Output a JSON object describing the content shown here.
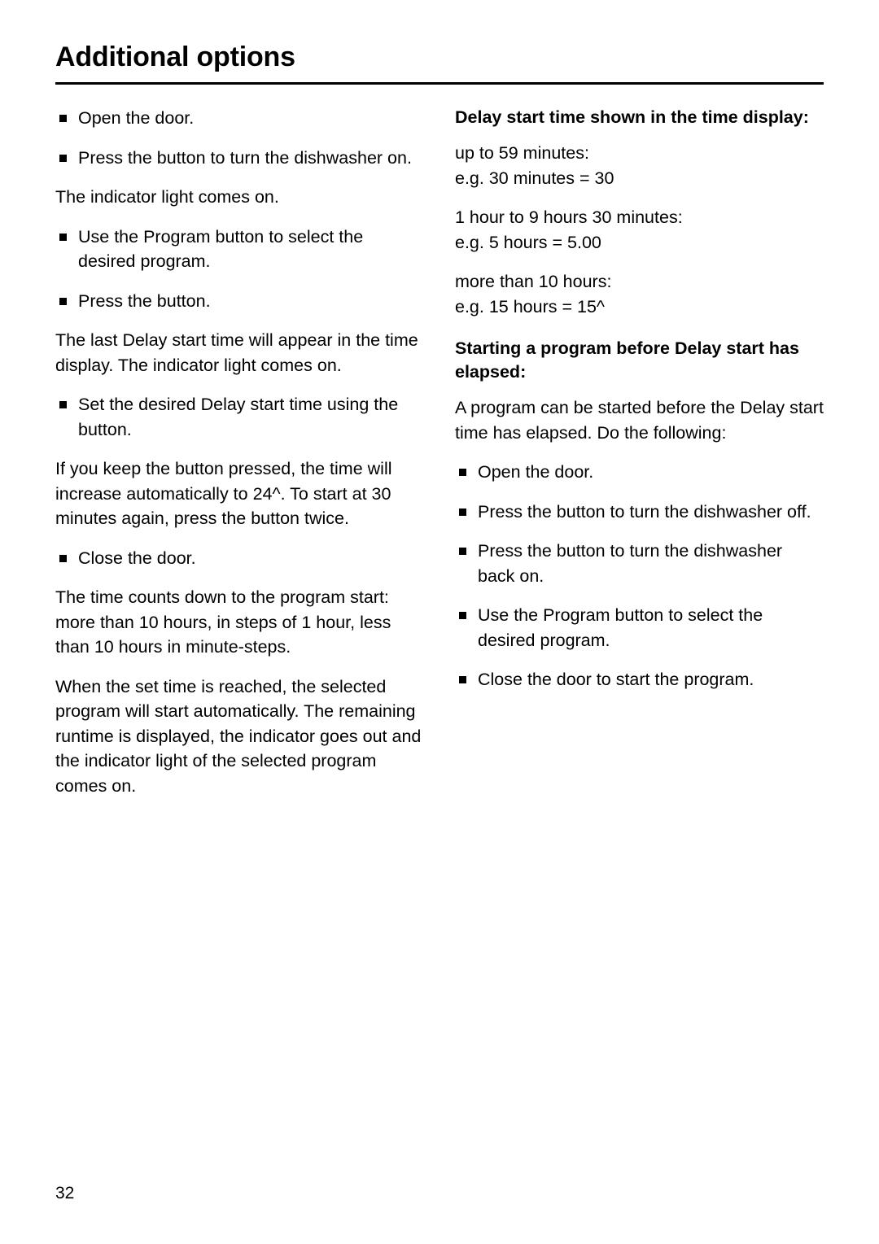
{
  "page": {
    "title": "Additional options",
    "number": "32"
  },
  "left_column": {
    "items": [
      {
        "type": "bullet",
        "text": "Open the door."
      },
      {
        "type": "bullet",
        "text": "Press the  button to turn the dishwasher on."
      },
      {
        "type": "para",
        "text": "The  indicator light comes on."
      },
      {
        "type": "bullet",
        "text": "Use the Program button to select the desired program."
      },
      {
        "type": "bullet",
        "text": "Press the  button."
      },
      {
        "type": "para",
        "text": "The last Delay start time will appear in the time display. The  indicator light comes on."
      },
      {
        "type": "bullet",
        "text": "Set the desired Delay start time using the  button."
      },
      {
        "type": "para",
        "text": "If you keep the  button pressed, the time will increase automatically to 24^. To start at 30 minutes again, press the  button twice."
      },
      {
        "type": "bullet",
        "text": "Close the door."
      },
      {
        "type": "para",
        "text": "The time counts down to the program start: more than 10 hours, in steps of 1 hour, less than 10 hours in minute-steps."
      },
      {
        "type": "para",
        "text": "When the set time is reached, the selected program will start automatically. The remaining runtime is displayed, the  indicator goes out and the indicator light of the selected program comes on."
      }
    ]
  },
  "right_column": {
    "section1": {
      "heading": "Delay start time shown in the time display:",
      "paragraphs": [
        "up to 59 minutes:\ne.g. 30 minutes = 30",
        "1 hour to 9 hours 30 minutes:\ne.g. 5 hours = 5.00",
        "more than 10 hours:\ne.g. 15 hours = 15^"
      ]
    },
    "section2": {
      "heading": "Starting a program before Delay start has elapsed:",
      "intro": "A program can be started before the Delay start time has elapsed. Do the following:",
      "items": [
        {
          "type": "bullet",
          "text": "Open the door."
        },
        {
          "type": "bullet",
          "text": "Press the  button to turn the dishwasher off."
        },
        {
          "type": "bullet",
          "text": "Press the  button to turn the dishwasher back on."
        },
        {
          "type": "bullet",
          "text": "Use the Program button to select the desired program."
        },
        {
          "type": "bullet",
          "text": "Close the door to start the program."
        }
      ]
    }
  }
}
